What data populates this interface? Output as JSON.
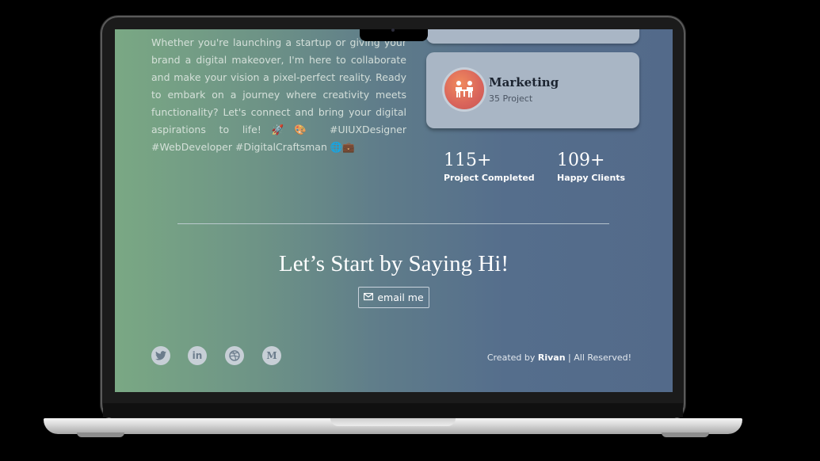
{
  "about": {
    "justified_lines": "Whether you're launching a startup or giving your brand a digital makeover, I'm here to collaborate and make your vision a pixel-perfect reality. Ready to embark on a journey where creativity meets functionality? Let's connect and bring your digital aspirations to life!🚀🎨 #UIUXDesigner",
    "last_line": "#WebDeveloper #DigitalCraftsman 🌐💼"
  },
  "service_card": {
    "title": "Marketing",
    "subtitle": "35 Project",
    "icon": "team-meeting-icon",
    "badge_color": "#e06c5a"
  },
  "stats": [
    {
      "value": "115+",
      "label": "Project Completed"
    },
    {
      "value": "109+",
      "label": "Happy Clients"
    }
  ],
  "cta": {
    "heading": "Let’s Start by Saying Hi!",
    "button_label": "email me",
    "button_icon": "email-icon"
  },
  "social": [
    {
      "name": "twitter-icon"
    },
    {
      "name": "linkedin-icon",
      "label": "in"
    },
    {
      "name": "dribbble-icon"
    },
    {
      "name": "medium-icon",
      "label": "M"
    }
  ],
  "footer": {
    "prefix": "Created by ",
    "author": "Rivan",
    "suffix": " | All Reserved!"
  },
  "colors": {
    "card_bg": "#a9b6c5",
    "gradient_start": "#7aa884",
    "gradient_end": "#536a8a"
  }
}
